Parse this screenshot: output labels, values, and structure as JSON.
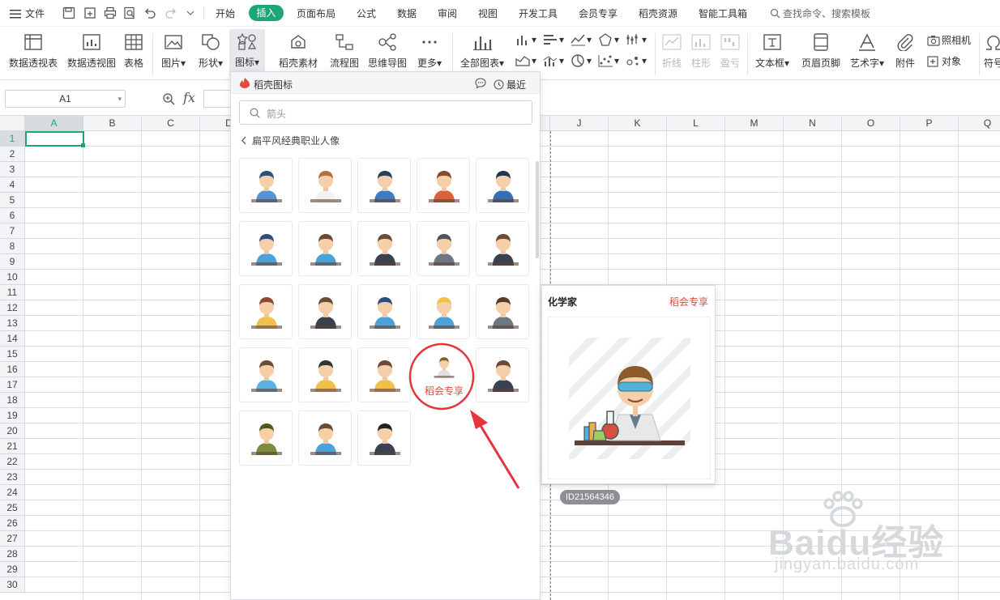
{
  "menubar": {
    "file_label": "文件",
    "tabs": [
      "开始",
      "插入",
      "页面布局",
      "公式",
      "数据",
      "审阅",
      "视图",
      "开发工具",
      "会员专享",
      "稻壳资源",
      "智能工具箱"
    ],
    "active_tab": "插入",
    "search_placeholder": "查找命令、搜索模板"
  },
  "ribbon": {
    "pivot_table": "数据透视表",
    "pivot_chart": "数据透视图",
    "table": "表格",
    "picture": "图片",
    "shape": "形状",
    "icon": "图标",
    "docer_material": "稻壳素材",
    "flowchart": "流程图",
    "mindmap": "思维导图",
    "more": "更多",
    "all_charts": "全部图表",
    "sparkline_line": "折线",
    "sparkline_column": "柱形",
    "sparkline_winloss": "盈亏",
    "textbox": "文本框",
    "header_footer": "页眉页脚",
    "wordart": "艺术字",
    "attachment": "附件",
    "camera": "照相机",
    "object": "对象",
    "symbol": "符号"
  },
  "formula_bar": {
    "cell_ref": "A1",
    "fx_label": "fx"
  },
  "sheet": {
    "columns": [
      "A",
      "B",
      "C",
      "D",
      "E",
      "F",
      "G",
      "H",
      "I",
      "J",
      "K",
      "L",
      "M",
      "N",
      "O",
      "P",
      "Q"
    ],
    "rows": [
      "1",
      "2",
      "3",
      "4",
      "5",
      "6",
      "7",
      "8",
      "9",
      "10",
      "11",
      "12",
      "13",
      "14",
      "15",
      "16",
      "17",
      "18",
      "19",
      "20",
      "21",
      "22",
      "23",
      "24",
      "25",
      "26",
      "27",
      "28",
      "29",
      "30"
    ],
    "active_cell": "A1"
  },
  "icon_panel": {
    "title": "稻壳图标",
    "recent_label": "最近",
    "search_placeholder": "箭头",
    "category": "扁平风经典职业人像",
    "premium_label": "稻会专享",
    "tiles": [
      {
        "name": "pilot"
      },
      {
        "name": "chef"
      },
      {
        "name": "postman"
      },
      {
        "name": "farmer"
      },
      {
        "name": "police"
      },
      {
        "name": "flight-attendant"
      },
      {
        "name": "programmer"
      },
      {
        "name": "judge"
      },
      {
        "name": "cashier"
      },
      {
        "name": "teacher"
      },
      {
        "name": "accountant"
      },
      {
        "name": "receptionist"
      },
      {
        "name": "doctor"
      },
      {
        "name": "worker"
      },
      {
        "name": "librarian"
      },
      {
        "name": "customer-service"
      },
      {
        "name": "graduate"
      },
      {
        "name": "driver"
      },
      {
        "name": "chemist"
      },
      {
        "name": "office-clerk"
      },
      {
        "name": "soldier"
      },
      {
        "name": "photographer"
      },
      {
        "name": "nun"
      }
    ]
  },
  "preview": {
    "title": "化学家",
    "badge": "稻会专享",
    "id_label": "ID21564346"
  },
  "watermark": {
    "brand": "Baidu经验",
    "url": "jingyan.baidu.com"
  },
  "colors": {
    "accent_green": "#1aa774",
    "premium_red": "#e04a3a",
    "annotation_red": "#e8333a"
  }
}
